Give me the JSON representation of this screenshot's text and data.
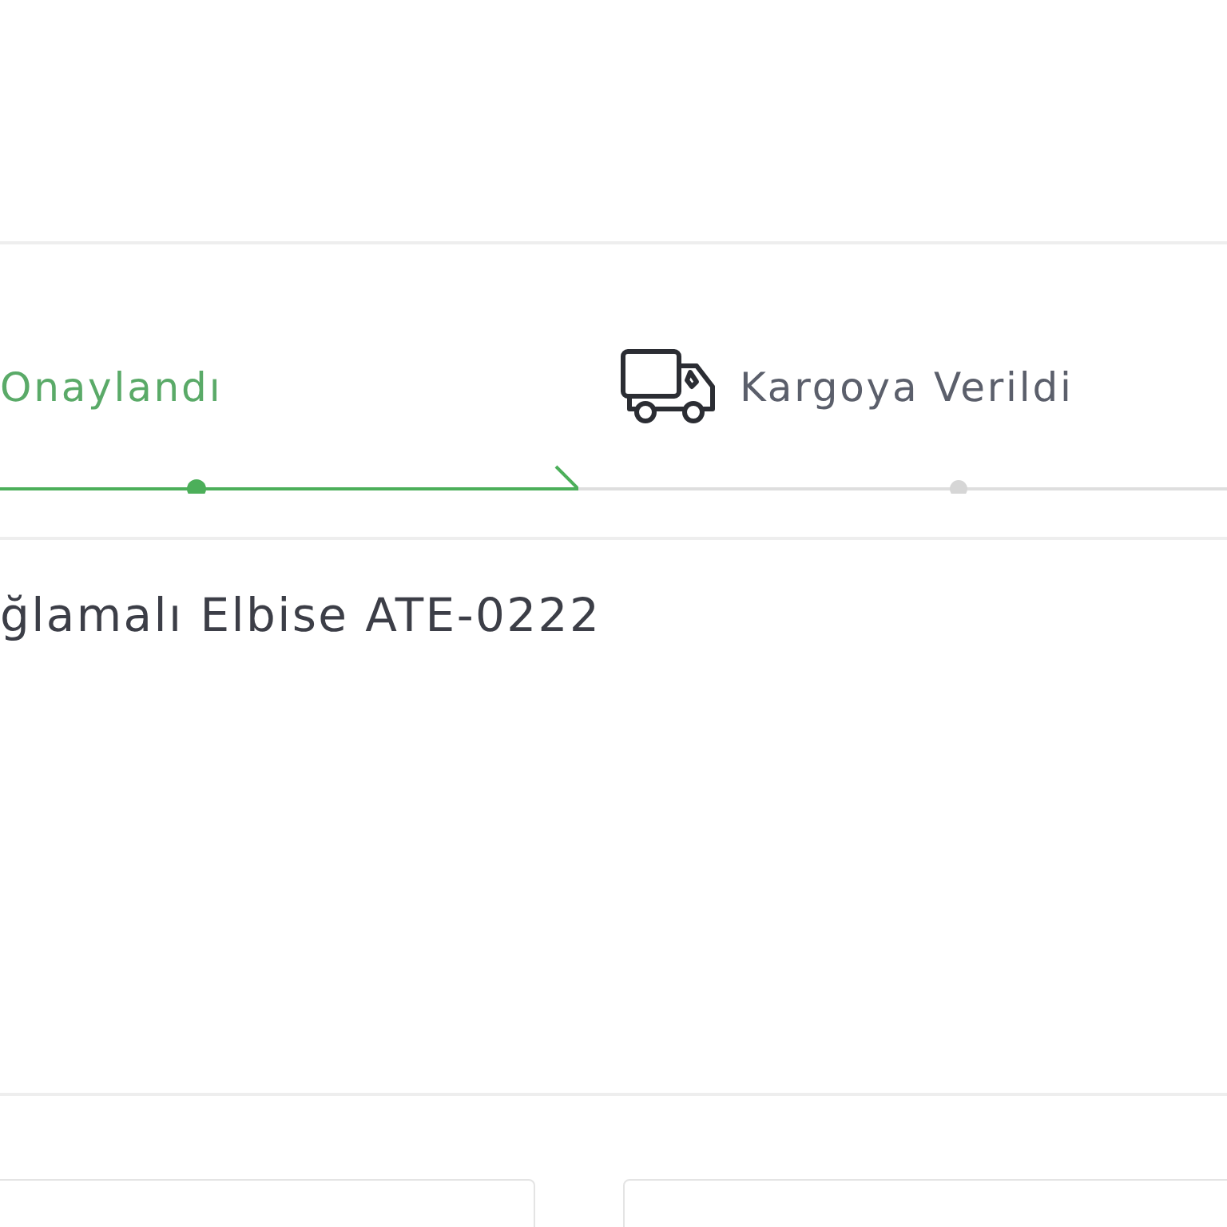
{
  "steps": [
    {
      "label": "Onaylandı",
      "kind": "confirmed",
      "completed": true
    },
    {
      "label": "Kargoya Verildi",
      "kind": "shipped",
      "completed": false
    }
  ],
  "product": {
    "name": "ğlamalı Elbise ATE-0222"
  },
  "panels": [
    {
      "kind": "card"
    },
    {
      "kind": "card"
    }
  ]
}
